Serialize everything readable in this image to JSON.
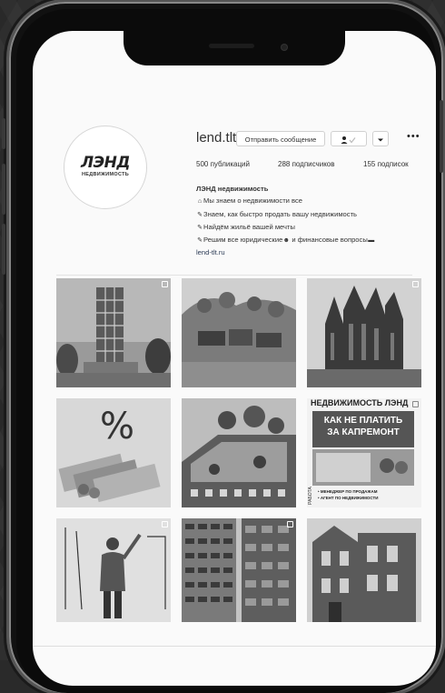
{
  "profile": {
    "username": "lend.tlt",
    "message_button": "Отправить сообщение",
    "follow_icon": "person-check-icon",
    "dropdown_icon": "chevron-down-icon",
    "more_icon": "more-horizontal-icon",
    "logo_text": "ЛЭНД",
    "logo_subtext": "НЕДВИЖИМОСТЬ",
    "stats": {
      "posts": "500 публикаций",
      "followers": "288 подписчиков",
      "following": "155 подписок"
    },
    "bio": {
      "name": "ЛЭНД недвижимость",
      "lines": [
        {
          "icon": "house-icon",
          "glyph": "⌂",
          "text": "Мы знаем о недвижимости все"
        },
        {
          "icon": "pin-icon",
          "glyph": "✎",
          "text": "Знаем, как быстро продать вашу недвижимость"
        },
        {
          "icon": "pin-icon",
          "glyph": "✎",
          "text": "Найдём жильё вашей мечты"
        },
        {
          "icon": "pin-icon",
          "glyph": "✎",
          "text": "Решим все юридические",
          "icon_mid": "people-icon",
          "glyph_mid": "☻",
          "text_after": " и финансовые вопросы",
          "icon_end": "money-icon",
          "glyph_end": "▬"
        }
      ],
      "link": "lend-tlt.ru"
    }
  },
  "posts": [
    {
      "name": "post-tower-building",
      "multi": true
    },
    {
      "name": "post-hillside-houses",
      "multi": false
    },
    {
      "name": "post-cathedral",
      "multi": true
    },
    {
      "name": "post-percent-money",
      "multi": false
    },
    {
      "name": "post-courtyard-render",
      "multi": false
    },
    {
      "name": "post-newspaper",
      "multi": true,
      "header": "НЕДВИЖИМОСТЬ ЛЭНД",
      "headline1": "КАК НЕ ПЛАТИТЬ",
      "headline2": "ЗА КАПРЕМОНТ",
      "side": "РАБОТА",
      "ad1": "• МЕНЕДЖЕР ПО ПРОДАЖАМ",
      "ad2": "• АГЕНТ ПО НЕДВИЖИМОСТИ"
    },
    {
      "name": "post-office-woman",
      "multi": true
    },
    {
      "name": "post-high-rise",
      "multi": true
    },
    {
      "name": "post-brick-house",
      "multi": false
    }
  ]
}
